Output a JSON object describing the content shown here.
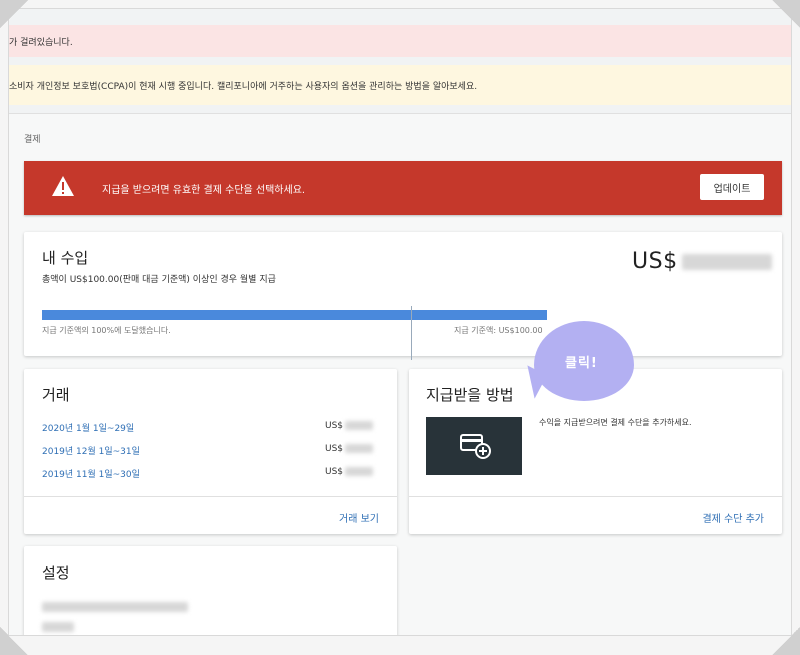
{
  "banners": {
    "red": "가 걸려있습니다.",
    "yellow": "소비자 개인정보 보호법(CCPA)이 현재 시행 중입니다. 캘리포니아에 거주하는 사용자의 옵션을 관리하는 방법을 알아보세요."
  },
  "breadcrumb": "결제",
  "alert": {
    "message": "지급을 받으려면 유효한 결제 수단을 선택하세요.",
    "button": "업데이트",
    "color": "#c5382b"
  },
  "earnings": {
    "title": "내 수입",
    "subtitle": "총액이 US$100.00(판매 대금 기준액) 이상인 경우 월별 지급",
    "amount_prefix": "US$",
    "progress_percent": 100,
    "progress_left_label": "지급 기준액의 100%에 도달했습니다.",
    "progress_right_label": "지급 기준액: US$100.00",
    "bar_color": "#4a89dc"
  },
  "transactions": {
    "title": "거래",
    "rows": [
      {
        "date": "2020년 1월 1일~29일",
        "currency": "US$"
      },
      {
        "date": "2019년 12월 1일~31일",
        "currency": "US$"
      },
      {
        "date": "2019년 11월 1일~30일",
        "currency": "US$"
      }
    ],
    "link": "거래 보기"
  },
  "payment": {
    "title": "지급받을 방법",
    "description": "수익을 지급받으려면 결제 수단을 추가하세요.",
    "icon": "add-card-icon",
    "link": "결제 수단 추가"
  },
  "settings": {
    "title": "설정"
  },
  "annotation": {
    "text": "클릭!",
    "color": "#b3b0f2"
  }
}
